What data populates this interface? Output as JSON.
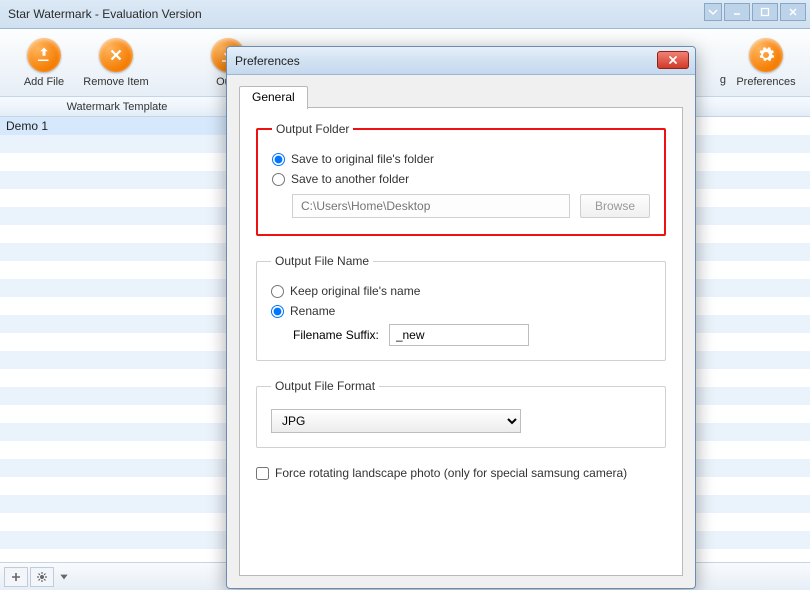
{
  "window": {
    "title": "Star Watermark - Evaluation Version"
  },
  "toolbar": {
    "add_file": "Add File",
    "remove_item": "Remove Item",
    "output_partial": "Outp",
    "preferences": "Preferences",
    "right_partial": "g"
  },
  "side": {
    "header": "Watermark Template",
    "row0": "Demo 1"
  },
  "dialog": {
    "title": "Preferences",
    "tab_general": "General",
    "group_output_folder": {
      "legend": "Output Folder",
      "opt_original": "Save to original file's folder",
      "opt_another": "Save to another folder",
      "path_placeholder": "C:\\Users\\Home\\Desktop",
      "browse": "Browse"
    },
    "group_output_name": {
      "legend": "Output File Name",
      "opt_keep": "Keep original file's name",
      "opt_rename": "Rename",
      "suffix_label": "Filename Suffix:",
      "suffix_value": "_new"
    },
    "group_format": {
      "legend": "Output File Format",
      "selected": "JPG"
    },
    "force_rotate": "Force rotating landscape photo (only for special samsung camera)"
  }
}
